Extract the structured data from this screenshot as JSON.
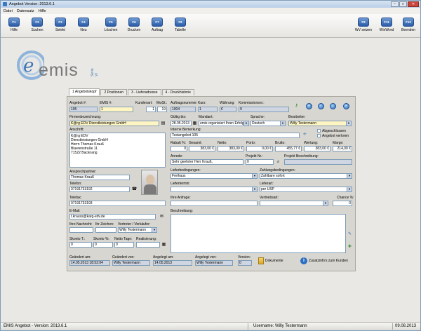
{
  "window": {
    "title": "Angebot Version: 2013.6.1",
    "min": "–",
    "max": "□",
    "close": "✕"
  },
  "menu": [
    "Datei",
    "Datensatz",
    "Hilfe"
  ],
  "toolbar": [
    {
      "key": "F1",
      "label": "Hilfe"
    },
    {
      "key": "F2",
      "label": "Suchen"
    },
    {
      "key": "F3",
      "label": "Selekt"
    },
    {
      "key": "F4",
      "label": "Neu"
    },
    {
      "key": "F5",
      "label": "Löschen"
    },
    {
      "key": "F6",
      "label": "Drucken"
    },
    {
      "key": "F7",
      "label": "Auftrag"
    },
    {
      "key": "F8",
      "label": "Tabelle"
    },
    {
      "key": "F9",
      "label": "WV setzen"
    },
    {
      "key": "F11",
      "label": "WinWord"
    },
    {
      "key": "F12",
      "label": "Beenden"
    }
  ],
  "logo": {
    "text": "emis",
    "sub": "Serie VI",
    "mark": "e"
  },
  "tabs": [
    "1 Angebotskopf",
    "2 Positionen",
    "3 - Lieferadresse",
    "4 - Druckhistorie"
  ],
  "form": {
    "angebot_label": "Angebot #:",
    "angebot": "105",
    "emis_label": "EMIS #:",
    "emis": "1",
    "kundenart_label": "Kundenart:",
    "kundenart": "1",
    "mwst_label": "MwSt.:",
    "mwst": "19",
    "auftragsnummer_label": "Auftragsnummer:",
    "auftragsnummer": "1004",
    "kurs_label": "Kurs:",
    "kurs": "1",
    "waehrung_label": "Währung:",
    "waehrung": "€",
    "kommissionsnr_label": "Kommissionsnr.:",
    "kommissionsnr": "9",
    "firmenbezeichnung_label": "Firmenbezeichnung:",
    "firmenbezeichnung": "K@rg EDV Dienstleistungen GmbH",
    "gueltig_label": "Gültig bis:",
    "gueltig": "28.05.2013",
    "mandant_label": "Mandant:",
    "mandant": "emis organisiert Ihren Erfolg",
    "sprache_label": "Sprache:",
    "sprache": "Deutsch",
    "bearbeiter_label": "Bearbeiter:",
    "bearbeiter": "Willy Testermann",
    "anschrift_label": "Anschrift:",
    "anschrift": [
      "K@rg EDV",
      "Dienstleistungen GmbH",
      "Herrn Thomas Krauß",
      "Bluerenstraße 11",
      "71522 Backnang"
    ],
    "interne_label": "Interne Bemerkung:",
    "interne": "Testangebot 105",
    "abgeschlossen": "Abgeschlossen",
    "verloren": "Angebot verloren",
    "rabatt_label": "Rabatt %:",
    "rabatt": "0",
    "gesamt_label": "Gesamt:",
    "gesamt": "383,00 €",
    "netto_label": "Netto:",
    "netto": "383,00 €",
    "porto_label": "Porto:",
    "porto": "0,00 €",
    "brutto_label": "Brutto:",
    "brutto": "455,77 €",
    "wertung_label": "Wertung:",
    "wertung": "383,00 €",
    "marge_label": "Marge:",
    "marge": "214,00 €",
    "anrede_label": "Anrede:",
    "anrede": "Sehr geehrter Herr Krauß,",
    "projektnr_label": "Projekt Nr.:",
    "projektnr": "0",
    "projektbeschreibung_label": "Projekt Beschreibung:",
    "ansprech_label": "Ansprechpartner:",
    "ansprech": "Thomas Krauß",
    "lieferbed_label": "Lieferbedingungen:",
    "lieferbed": "Freihaus",
    "zahlbed_label": "Zahlungsbedingungen:",
    "zahlbed": "Zahlbare sofort",
    "telefon_label": "Telefon:",
    "telefon": "07191733192",
    "liefertermin_label": "Liefertermin:",
    "liefertermin": "",
    "lieferart_label": "Lieferart:",
    "lieferart": "per USP",
    "telefax_label": "Telefax:",
    "telefax": "07191733193",
    "anfrage_label": "Ihre Anfrage:",
    "anfrage": "",
    "vertriebsart_label": "Vertriebsart:",
    "vertriebsart": "",
    "chance_label": "Chance %:",
    "chance": "0",
    "email_label": "E-Mail:",
    "email": "t.krauss@karg-edv.de",
    "beschreibung_label": "Beschreibung:",
    "nachricht_label": "Ihre Nachricht:",
    "zeichen_label": "Ihr Zeichen:",
    "vertreter_label": "Vertreter / Verkäufer:",
    "vertreter": "Willy Testermann",
    "skontot_label": "Skonto T.:",
    "skontot": "0",
    "skontop_label": "Skonto %:",
    "skontop": "0",
    "nettotage_label": "Netto Tage:",
    "nettotage": "0",
    "realisierung_label": "Realisierung:",
    "realisierung": "",
    "geaendert_am_label": "Geändert am:",
    "geaendert_am": "14.05.2013 18:53:04",
    "geaendert_von_label": "Geändert von:",
    "geaendert_von": "Willy Testermann",
    "angelegt_am_label": "Angelegt am:",
    "angelegt_am": "14.05.2013",
    "angelegt_von_label": "Angelegt von:",
    "angelegt_von": "Willy Testermann",
    "version_label": "Version:",
    "version": "0",
    "dokumente": "Dokumente",
    "zusatzinfo": "Zusatzinfo's zum Kunden"
  },
  "status": {
    "left": "EMIS Angebot - Version: 2013.6.1",
    "user": "Username: Willy Testermann",
    "date": "09.08.2013"
  },
  "colors": {
    "accent": "#2b6fc2",
    "highlight_field": "#fff5c2",
    "readonly_field": "#cfd6e2"
  }
}
